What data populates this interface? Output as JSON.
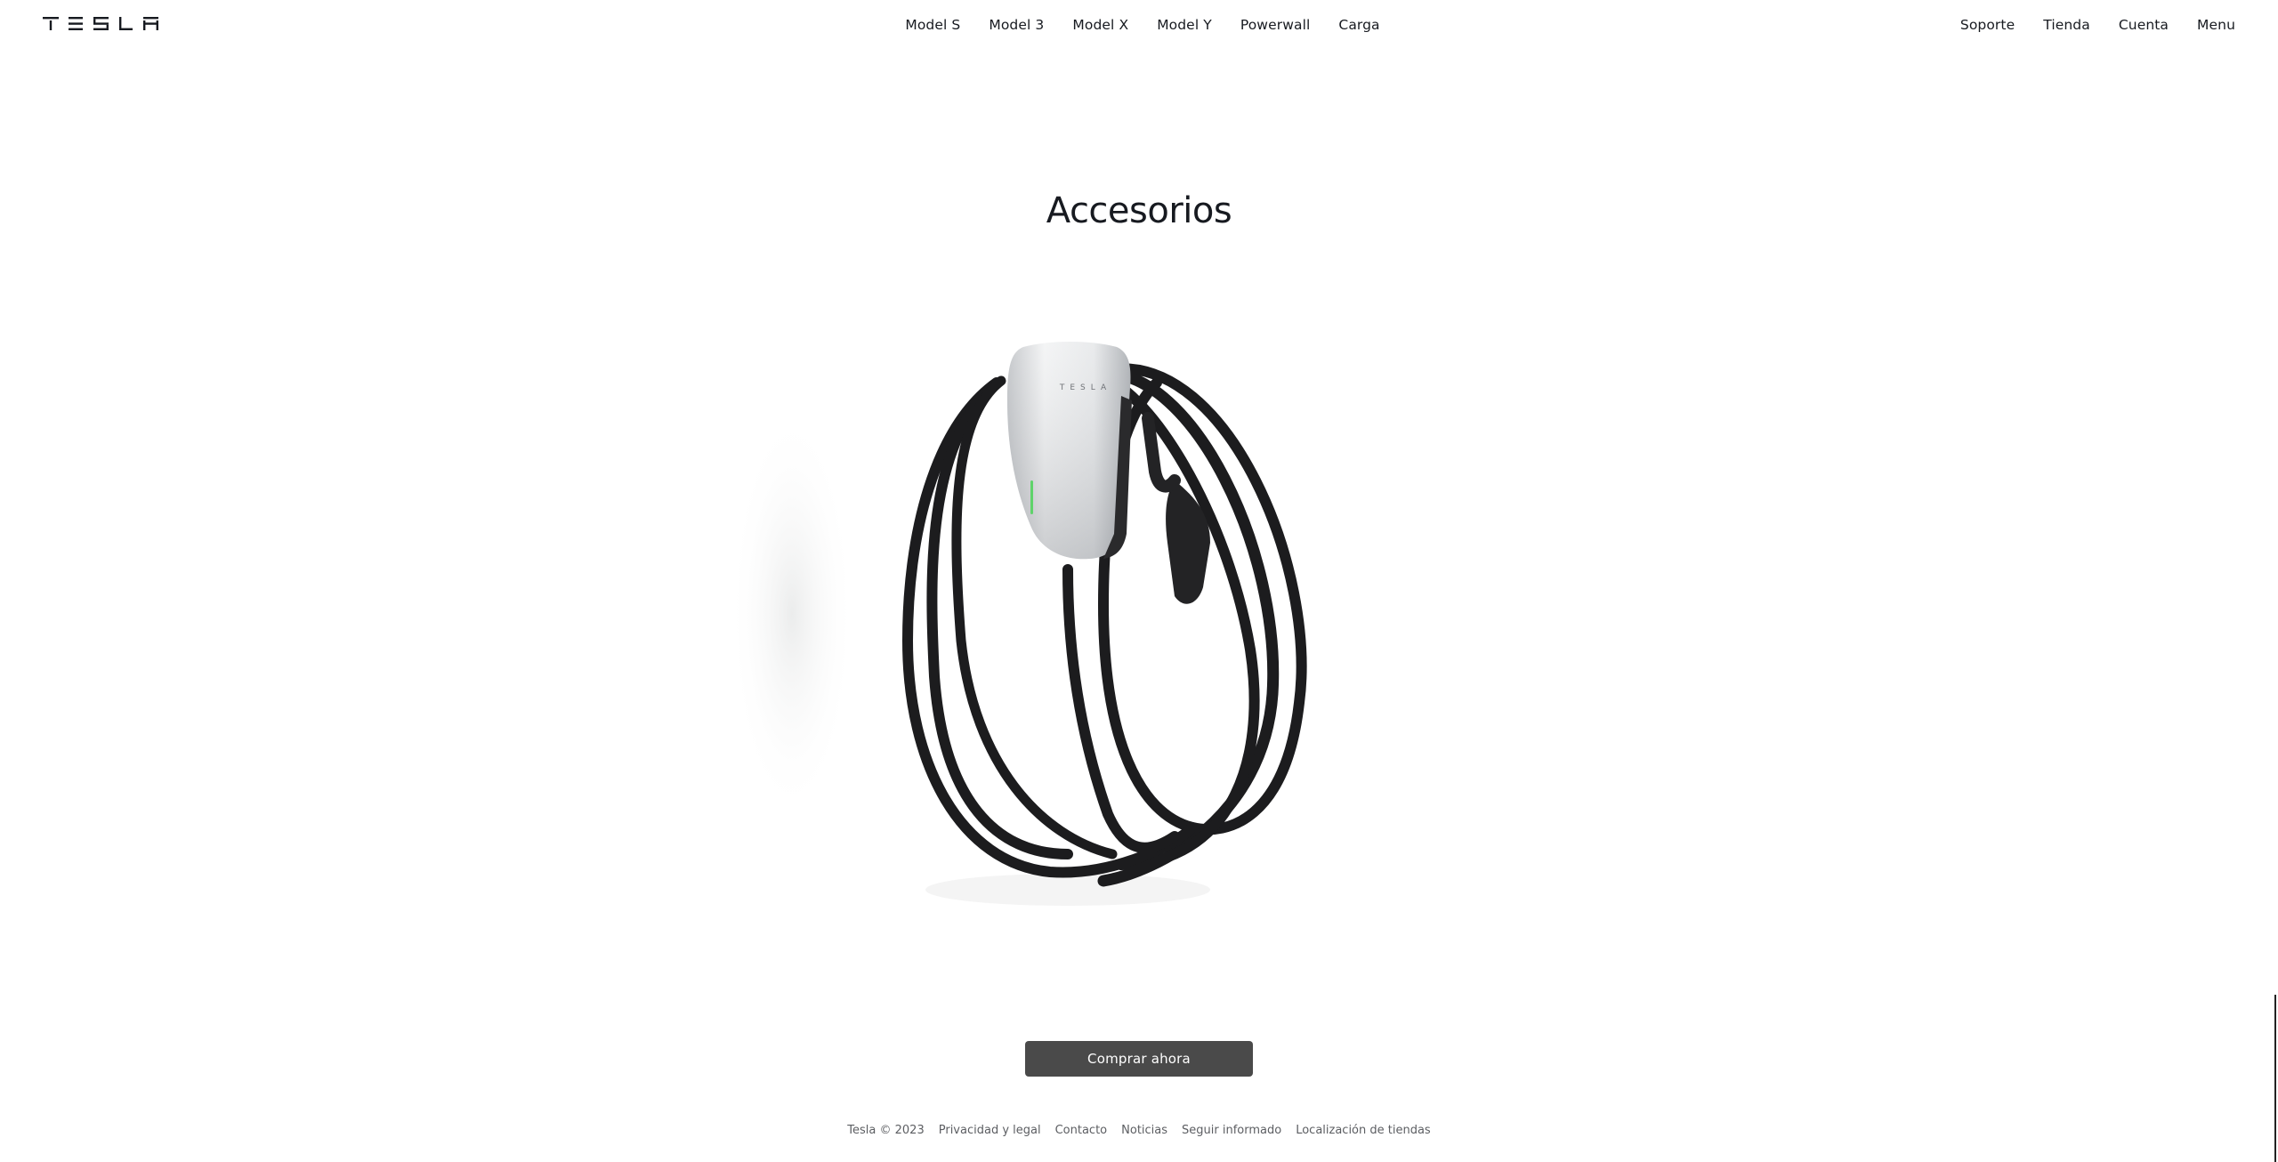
{
  "header": {
    "logo_text": "TESLA",
    "nav_center": [
      "Model S",
      "Model 3",
      "Model X",
      "Model Y",
      "Powerwall",
      "Carga"
    ],
    "nav_right": [
      "Soporte",
      "Tienda",
      "Cuenta",
      "Menu"
    ]
  },
  "main": {
    "title": "Accesorios",
    "product_image": "wall-connector-charger",
    "product_logo_text": "TESLA",
    "cta_label": "Comprar ahora"
  },
  "footer": {
    "links": [
      "Tesla © 2023",
      "Privacidad y legal",
      "Contacto",
      "Noticias",
      "Seguir informado",
      "Localización de tiendas"
    ]
  },
  "colors": {
    "text_primary": "#171a20",
    "cta_background": "#4a4a4a",
    "cta_text": "#ffffff",
    "footer_text": "#5c5e62",
    "status_light": "#5fd36a"
  }
}
